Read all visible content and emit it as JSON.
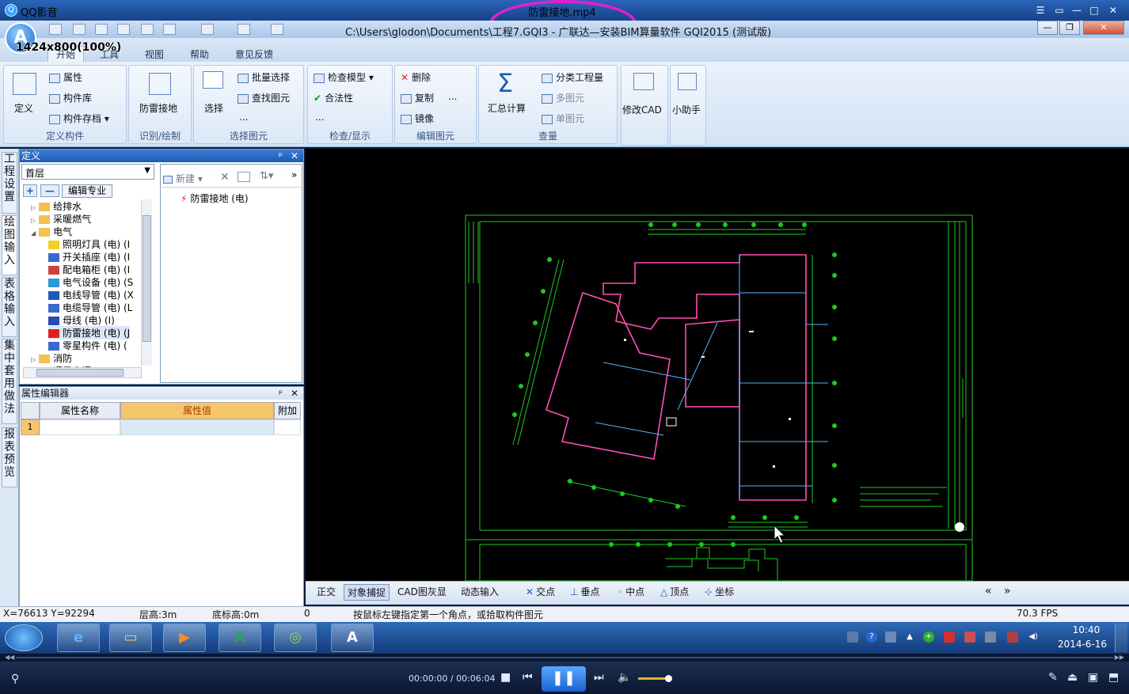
{
  "player": {
    "app_name": "QQ影音",
    "file_name": "防雷接地.mp4",
    "timecode": "00:00:00 / 00:06:04"
  },
  "app": {
    "title": "C:\\Users\\glodon\\Documents\\工程7.GQI3 - 广联达—安装BIM算量软件 GQI2015 (测试版)",
    "logo": "A",
    "resolution_label": "1424x800(100%)"
  },
  "ribbon": {
    "tabs": [
      "开始",
      "工具",
      "视图",
      "帮助",
      "意见反馈"
    ],
    "groups": {
      "define": {
        "label": "定义构件",
        "big": "定义",
        "items": [
          "属性",
          "构件库",
          "构件存档"
        ]
      },
      "identify": {
        "label": "识别/绘制",
        "big": "防雷接地"
      },
      "select": {
        "label": "选择图元",
        "big": "选择",
        "items": [
          "批量选择",
          "查找图元",
          "..."
        ]
      },
      "check": {
        "label": "检查/显示",
        "items": [
          "检查模型",
          "合法性",
          "..."
        ]
      },
      "edit": {
        "label": "编辑图元",
        "items": [
          "删除",
          "复制",
          "镜像",
          "..."
        ]
      },
      "quantity": {
        "label": "查量",
        "big": "汇总计算",
        "items": [
          "分类工程量",
          "多图元",
          "单图元"
        ]
      },
      "cad": {
        "big": "修改CAD"
      },
      "helper": {
        "big": "小助手"
      }
    }
  },
  "side_tabs": [
    "工程设置",
    "绘图输入",
    "表格输入",
    "集中套用做法",
    "报表预览"
  ],
  "define_panel": {
    "title": "定义",
    "floor": "首层",
    "edit_major": "编辑专业",
    "tree": [
      {
        "label": "给排水",
        "level": 0,
        "icon": "folder-icon"
      },
      {
        "label": "采暖燃气",
        "level": 0,
        "icon": "folder-icon"
      },
      {
        "label": "电气",
        "level": 0,
        "icon": "folder-open-icon"
      },
      {
        "label": "照明灯具 (电) (I",
        "level": 1,
        "icon": "lamp-icon"
      },
      {
        "label": "开关插座 (电) (I",
        "level": 1,
        "icon": "switch-icon"
      },
      {
        "label": "配电箱柜 (电) (I",
        "level": 1,
        "icon": "cabinet-icon"
      },
      {
        "label": "电气设备 (电) (S",
        "level": 1,
        "icon": "device-icon"
      },
      {
        "label": "电线导管 (电) (X",
        "level": 1,
        "icon": "conduit-icon"
      },
      {
        "label": "电缆导管 (电) (L",
        "level": 1,
        "icon": "cable-icon"
      },
      {
        "label": "母线 (电) (I)",
        "level": 1,
        "icon": "busbar-icon"
      },
      {
        "label": "防雷接地 (电) (J",
        "level": 1,
        "icon": "lightning-icon"
      },
      {
        "label": "零星构件 (电) (",
        "level": 1,
        "icon": "grid-icon"
      },
      {
        "label": "消防",
        "level": 0,
        "icon": "folder-icon"
      },
      {
        "label": "通风空调",
        "level": 0,
        "icon": "folder-icon"
      }
    ],
    "list_toolbar": {
      "new": "新建"
    },
    "list_items": [
      "防雷接地 (电)"
    ]
  },
  "attr_panel": {
    "title": "属性编辑器",
    "columns": [
      "属性名称",
      "属性值",
      "附加"
    ],
    "rows": [
      {
        "num": "1",
        "name": "",
        "value": "",
        "extra": ""
      }
    ]
  },
  "snapbar": {
    "items": [
      "正交",
      "对象捕捉",
      "CAD图灰显",
      "动态输入",
      "交点",
      "垂点",
      "中点",
      "顶点",
      "坐标"
    ],
    "nav": [
      "«",
      "»"
    ]
  },
  "status": {
    "coords": "X=76613 Y=92294",
    "floor_height": "层高:3m",
    "base_height": "底标高:0m",
    "value": "0",
    "hint": "按鼠标左键指定第一个角点，或拾取构件图元",
    "fps": "70.3 FPS"
  },
  "taskbar": {
    "time": "10:40",
    "date": "2014-6-16"
  },
  "colors": {
    "accent": "#1e5bb5",
    "highlight": "#e020d0",
    "cad_green": "#1fc81f",
    "cad_pink": "#ff4fb5",
    "cad_cyan": "#4fb4ff"
  }
}
